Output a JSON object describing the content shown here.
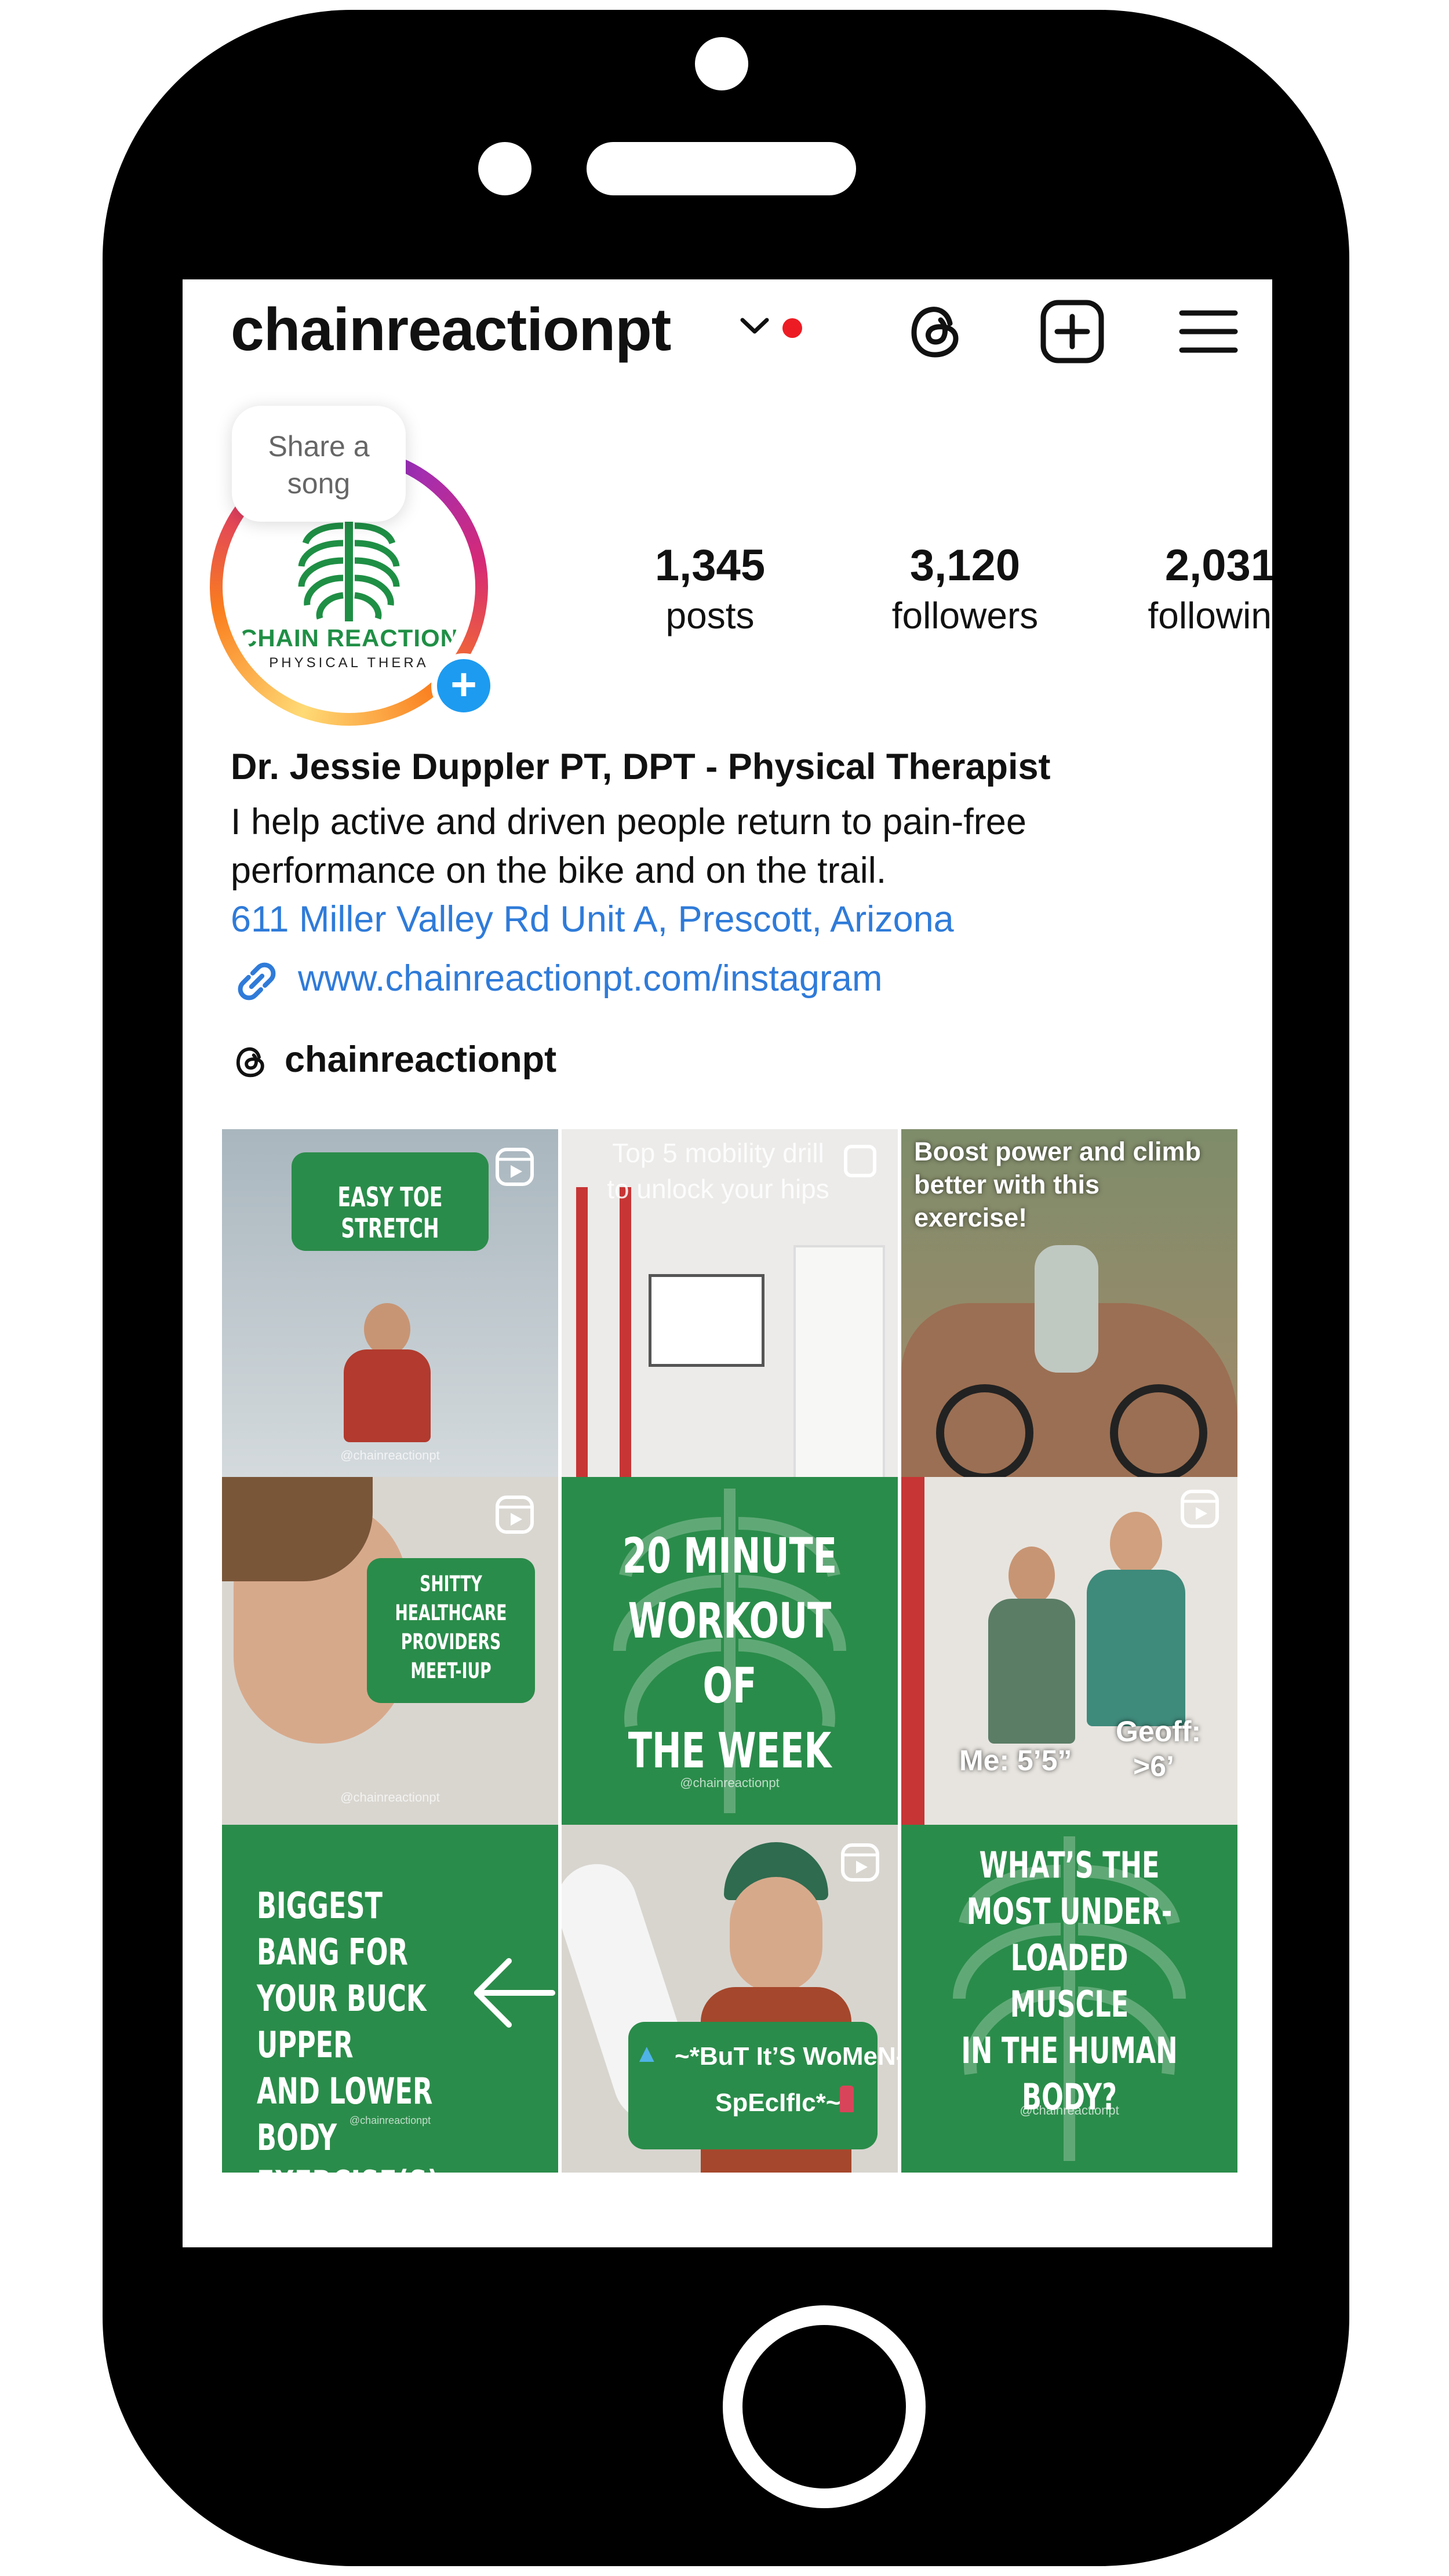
{
  "header": {
    "username": "chainreactionpt"
  },
  "profile": {
    "share_bubble": [
      "Share a",
      "song"
    ],
    "logo_line1": "CHAIN REACTION",
    "logo_line2": "PHYSICAL THERA",
    "stats": [
      {
        "value": "1,345",
        "label": "posts"
      },
      {
        "value": "3,120",
        "label": "followers"
      },
      {
        "value": "2,031",
        "label": "following"
      }
    ],
    "name": "Dr. Jessie Duppler PT, DPT - Physical Therapist",
    "bio": [
      "I help active and driven people return to pain-free",
      "performance on the bike and on the trail."
    ],
    "address": "611 Miller Valley Rd Unit A, Prescott, Arizona",
    "link": "www.chainreactionpt.com/instagram",
    "threads_handle": "chainreactionpt"
  },
  "posts": [
    {
      "overlay": "EASY TOE STRETCH",
      "handle": "@chainreactionpt",
      "icon": "reel-icon"
    },
    {
      "overlay": [
        "Top 5 mobility drill",
        "to unlock your hips"
      ],
      "icon": "carousel-icon"
    },
    {
      "overlay": [
        "Boost power and climb",
        "better with this",
        "exercise!"
      ]
    },
    {
      "overlay": [
        "SHITTY",
        "HEALTHCARE",
        "PROVIDERS",
        "MEET-IUP"
      ],
      "handle": "@chainreactionpt",
      "icon": "reel-icon"
    },
    {
      "overlay": [
        "20 MINUTE",
        "WORKOUT OF",
        "THE WEEK"
      ],
      "handle": "@chainreactionpt"
    },
    {
      "overlay": [
        "Me: 5’5”",
        "Geoff:",
        ">6’"
      ],
      "icon": "reel-icon"
    },
    {
      "overlay": [
        "BIGGEST BANG FOR",
        "YOUR BUCK UPPER",
        "AND LOWER BODY",
        "EXERCISE(S)"
      ],
      "handle": "@chainreactionpt"
    },
    {
      "overlay": [
        "~*BuT It’S WoMeN-",
        "SpEcIfIc*~"
      ],
      "icon": "reel-icon"
    },
    {
      "overlay": [
        "WHAT’S THE",
        "MOST UNDER-",
        "LOADED MUSCLE",
        "IN THE HUMAN",
        "BODY?"
      ],
      "handle": "@chainreactionpt"
    }
  ],
  "colors": {
    "brand_green": "#2a8c4a",
    "link_blue": "#2f7bd9",
    "notif_red": "#ed1c24",
    "badge_blue": "#1d9bf0"
  }
}
